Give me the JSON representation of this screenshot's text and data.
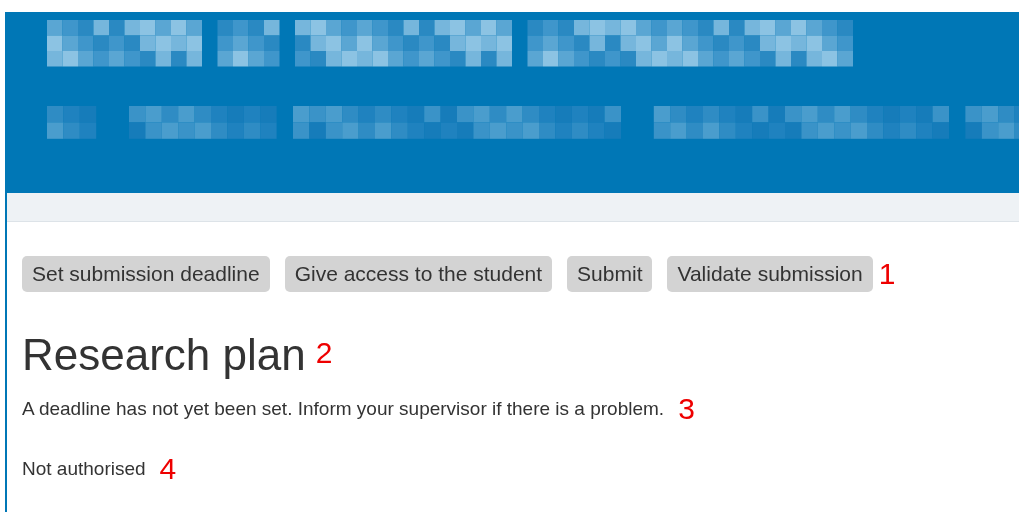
{
  "toolbar": {
    "buttons": [
      {
        "label": "Set submission deadline"
      },
      {
        "label": "Give access to the student"
      },
      {
        "label": "Submit"
      },
      {
        "label": "Validate submission"
      }
    ],
    "annotation": "1"
  },
  "heading": {
    "text": "Research plan",
    "annotation": "2"
  },
  "deadline_notice": {
    "text": "A deadline has not yet been set. Inform your supervisor if there is a problem.",
    "annotation": "3"
  },
  "access_status": {
    "text": "Not authorised",
    "annotation": "4"
  }
}
